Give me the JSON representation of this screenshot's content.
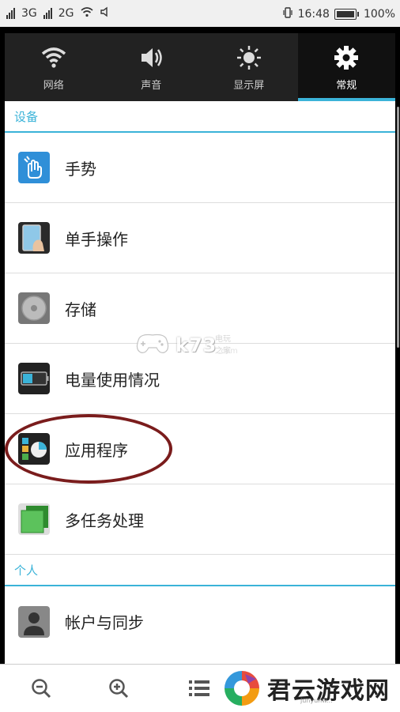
{
  "status_bar": {
    "net1": "3G",
    "net2": "2G",
    "time": "16:48",
    "battery": "100%"
  },
  "tabs": [
    {
      "label": "网络",
      "icon": "wifi-icon"
    },
    {
      "label": "声音",
      "icon": "speaker-icon"
    },
    {
      "label": "显示屏",
      "icon": "brightness-icon"
    },
    {
      "label": "常规",
      "icon": "gear-icon",
      "active": true
    }
  ],
  "sections": {
    "device": "设备",
    "personal": "个人"
  },
  "settings_items": [
    {
      "label": "手势",
      "icon": "gesture-icon"
    },
    {
      "label": "单手操作",
      "icon": "one-hand-icon"
    },
    {
      "label": "存储",
      "icon": "storage-icon"
    },
    {
      "label": "电量使用情况",
      "icon": "battery-usage-icon"
    },
    {
      "label": "应用程序",
      "icon": "apps-icon"
    },
    {
      "label": "多任务处理",
      "icon": "multitask-icon"
    }
  ],
  "personal_items": [
    {
      "label": "帐户与同步",
      "icon": "account-icon"
    }
  ],
  "watermark": {
    "text": "k73",
    "sub": "电玩之家",
    "domain": ".com"
  },
  "bottom_bar": {
    "zoom_out": "zoom-out-icon",
    "zoom_in": "zoom-in-icon",
    "menu": "list-icon"
  },
  "brand": {
    "name": "君云游戏网",
    "site": "junyunw..."
  },
  "colors": {
    "accent": "#3bb3d8",
    "annotation": "#7a1c1c"
  }
}
